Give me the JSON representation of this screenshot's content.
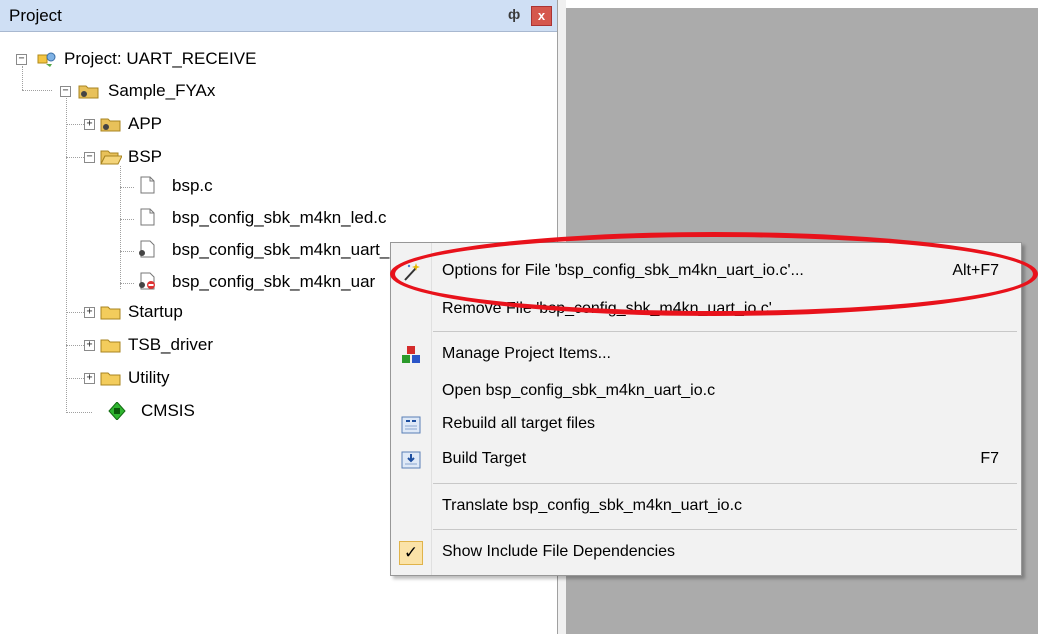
{
  "panel": {
    "title": "Project",
    "pin_glyph": "ф",
    "close_glyph": "x"
  },
  "tree": {
    "project": "Project: UART_RECEIVE",
    "target": "Sample_FYAx",
    "groups": {
      "app": "APP",
      "bsp": "BSP",
      "startup": "Startup",
      "tsb_driver": "TSB_driver",
      "utility": "Utility",
      "cmsis": "CMSIS"
    },
    "files": {
      "f1": "bsp.c",
      "f2": "bsp_config_sbk_m4kn_led.c",
      "f3": "bsp_config_sbk_m4kn_uart_io.c",
      "f4": "bsp_config_sbk_m4kn_uar"
    },
    "expander_plus": "+",
    "expander_minus": "−"
  },
  "menu": {
    "items": [
      {
        "label": "Options for File 'bsp_config_sbk_m4kn_uart_io.c'...",
        "shortcut": "Alt+F7"
      },
      {
        "label": "Remove File 'bsp_config_sbk_m4kn_uart_io.c'",
        "shortcut": ""
      },
      {
        "label": "Manage Project Items...",
        "shortcut": ""
      },
      {
        "label": "Open bsp_config_sbk_m4kn_uart_io.c",
        "shortcut": ""
      },
      {
        "label": "Rebuild all target files",
        "shortcut": ""
      },
      {
        "label": "Build Target",
        "shortcut": "F7"
      },
      {
        "label": "Translate bsp_config_sbk_m4kn_uart_io.c",
        "shortcut": ""
      },
      {
        "label": "Show Include File Dependencies",
        "shortcut": ""
      }
    ],
    "check_glyph": "✓"
  },
  "colors": {
    "highlight_ellipse": "#e8121b",
    "panel_title_bg": "#cfdff4",
    "gray_area": "#ababab"
  }
}
